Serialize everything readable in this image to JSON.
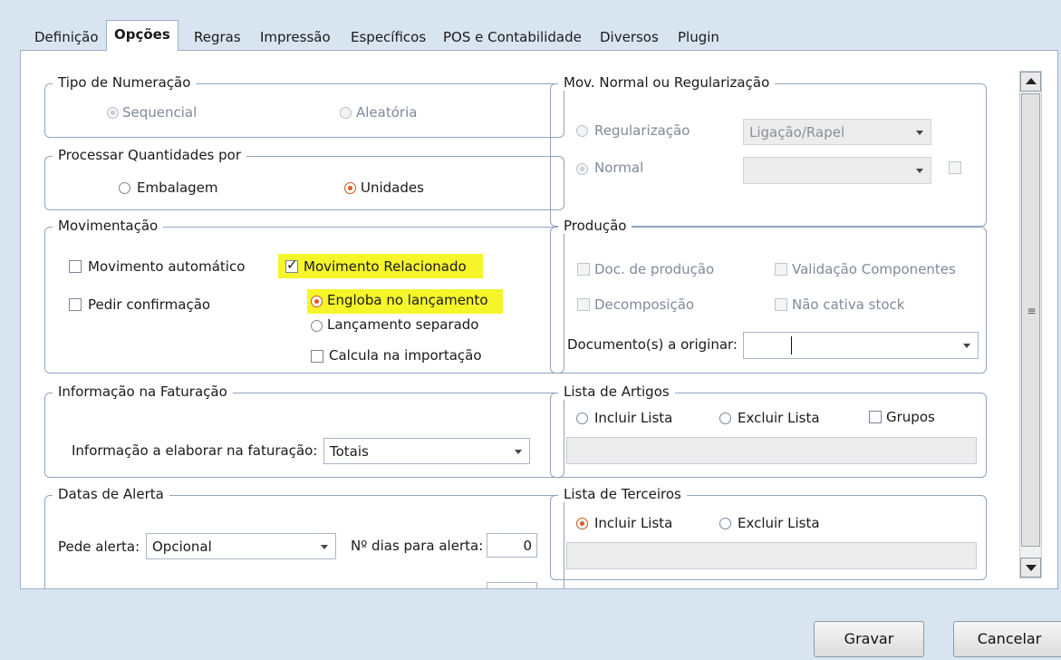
{
  "tabs": [
    {
      "label": "Definição"
    },
    {
      "label": "Opções",
      "active": true
    },
    {
      "label": "Regras"
    },
    {
      "label": "Impressão"
    },
    {
      "label": "Específicos"
    },
    {
      "label": "POS e Contabilidade"
    },
    {
      "label": "Diversos"
    },
    {
      "label": "Plugin"
    }
  ],
  "tipo_numeracao": {
    "title": "Tipo de Numeração",
    "sequencial": "Sequencial",
    "aleatoria": "Aleatória",
    "selected": "Sequencial"
  },
  "processar_quantidades": {
    "title": "Processar Quantidades por",
    "embalagem": "Embalagem",
    "unidades": "Unidades",
    "selected": "Unidades"
  },
  "movimentacao": {
    "title": "Movimentação",
    "movimento_automatico": "Movimento automático",
    "pedir_confirmacao": "Pedir confirmação",
    "movimento_relacionado": "Movimento Relacionado",
    "engloba_lancamento": "Engloba no lançamento",
    "lancamento_separado": "Lançamento separado",
    "calcula_importacao": "Calcula na importação"
  },
  "informacao_faturacao": {
    "title": "Informação na Faturação",
    "field_label": "Informação a elaborar na faturação:",
    "value": "Totais"
  },
  "datas_alerta": {
    "title": "Datas de Alerta",
    "pede_alerta_label": "Pede alerta:",
    "pede_alerta_value": "Opcional",
    "dias_label": "Nº dias para alerta:",
    "dias_value": "0"
  },
  "mov_normal": {
    "title": "Mov. Normal ou Regularização",
    "regularizacao": "Regularização",
    "regularizacao_value": "Ligação/Rapel",
    "normal": "Normal",
    "normal_value": ""
  },
  "producao": {
    "title": "Produção",
    "doc_producao": "Doc. de produção",
    "validacao_componentes": "Validação Componentes",
    "decomposicao": "Decomposição",
    "nao_cativa_stock": "Não cativa stock",
    "documentos_label": "Documento(s) a originar:",
    "documentos_value": ""
  },
  "lista_artigos": {
    "title": "Lista de Artigos",
    "incluir": "Incluir Lista",
    "excluir": "Excluir Lista",
    "grupos": "Grupos"
  },
  "lista_terceiros": {
    "title": "Lista de Terceiros",
    "incluir": "Incluir Lista",
    "excluir": "Excluir Lista",
    "selected": "Incluir Lista"
  },
  "buttons": {
    "gravar": "Gravar",
    "cancelar": "Cancelar"
  },
  "colors": {
    "highlight": "#f5f52a",
    "radio_selected": "#e2571e",
    "background": "#d9e4f1"
  }
}
